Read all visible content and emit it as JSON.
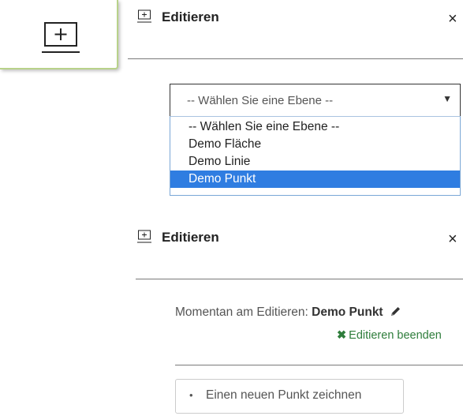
{
  "tool_button": {
    "icon": "add-square-icon"
  },
  "panel_top": {
    "icon": "add-square-icon",
    "title": "Editieren",
    "close": "×"
  },
  "layer_select": {
    "selected": "-- Wählen Sie eine Ebene --",
    "caret": "▼",
    "options": [
      "-- Wählen Sie eine Ebene --",
      "Demo Fläche",
      "Demo Linie",
      "Demo Punkt"
    ],
    "highlighted_option": "Demo Punkt"
  },
  "panel_bottom": {
    "icon": "add-square-icon",
    "title": "Editieren",
    "close": "×",
    "status_label": "Momentan am Editieren:",
    "status_layer": "Demo Punkt",
    "status_icon": "pencil-icon",
    "end_edit_icon": "x-icon",
    "end_edit_label": "Editieren beenden",
    "new_point_bullet": "•",
    "new_point_label": "Einen neuen Punkt zeichnen"
  },
  "colors": {
    "tool_button_border": "#b8d28a",
    "highlight": "#2f7de1",
    "end_edit": "#2e7d3b"
  }
}
